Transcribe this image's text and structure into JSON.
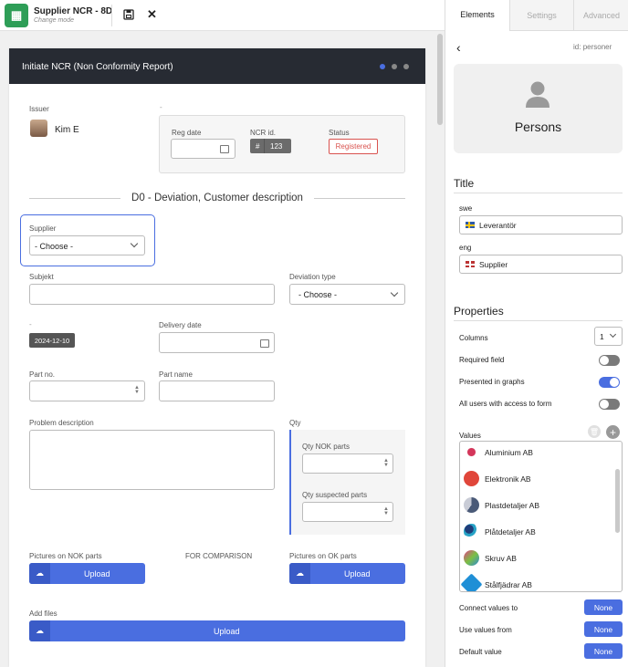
{
  "app": {
    "title": "Supplier NCR - 8D",
    "subtitle": "Change mode"
  },
  "form": {
    "title": "Initiate NCR (Non Conformity Report)",
    "issuer_label": "Issuer",
    "issuer_name": "Kim E",
    "dash": "-",
    "reg_date_label": "Reg date",
    "ncr_label": "NCR id.",
    "ncr_hash": "#",
    "ncr_value": "123",
    "status_label": "Status",
    "status_value": "Registered",
    "section_title": "D0 - Deviation, Customer description",
    "supplier_label": "Supplier",
    "supplier_value": "- Choose -",
    "subject_label": "Subjekt",
    "deviation_label": "Deviation type",
    "deviation_value": "- Choose -",
    "date_badge": "2024-12-10",
    "delivery_label": "Delivery date",
    "partno_label": "Part no.",
    "partname_label": "Part name",
    "problem_label": "Problem description",
    "qty_label": "Qty",
    "qty_nok_label": "Qty NOK parts",
    "qty_susp_label": "Qty suspected parts",
    "pics_nok_label": "Pictures on NOK parts",
    "for_comparison": "FOR COMPARISON",
    "pics_ok_label": "Pictures on OK parts",
    "upload": "Upload",
    "add_files_label": "Add files"
  },
  "panel": {
    "tabs": [
      "Elements",
      "Settings",
      "Advanced"
    ],
    "id_label": "id:",
    "id_value": "personer",
    "element_name": "Persons",
    "title_heading": "Title",
    "swe_label": "swe",
    "swe_value": "Leverantör",
    "eng_label": "eng",
    "eng_value": "Supplier",
    "properties_heading": "Properties",
    "columns_label": "Columns",
    "columns_value": "1",
    "required_label": "Required field",
    "graphs_label": "Presented in graphs",
    "allusers_label": "All users with access to form",
    "values_label": "Values",
    "values": [
      "Aluminium AB",
      "Elektronik AB",
      "Plastdetaljer AB",
      "Plåtdetaljer AB",
      "Skruv AB",
      "Stålfjädrar AB"
    ],
    "connect_label": "Connect values to",
    "usefrom_label": "Use values from",
    "default_label": "Default value",
    "none": "None"
  },
  "toggles": {
    "required": false,
    "graphs": true,
    "allusers": false
  },
  "colors": {
    "accent": "#4a6ee0",
    "header": "#272b33",
    "status_red": "#d9534f",
    "app_green": "#2e9e57"
  }
}
